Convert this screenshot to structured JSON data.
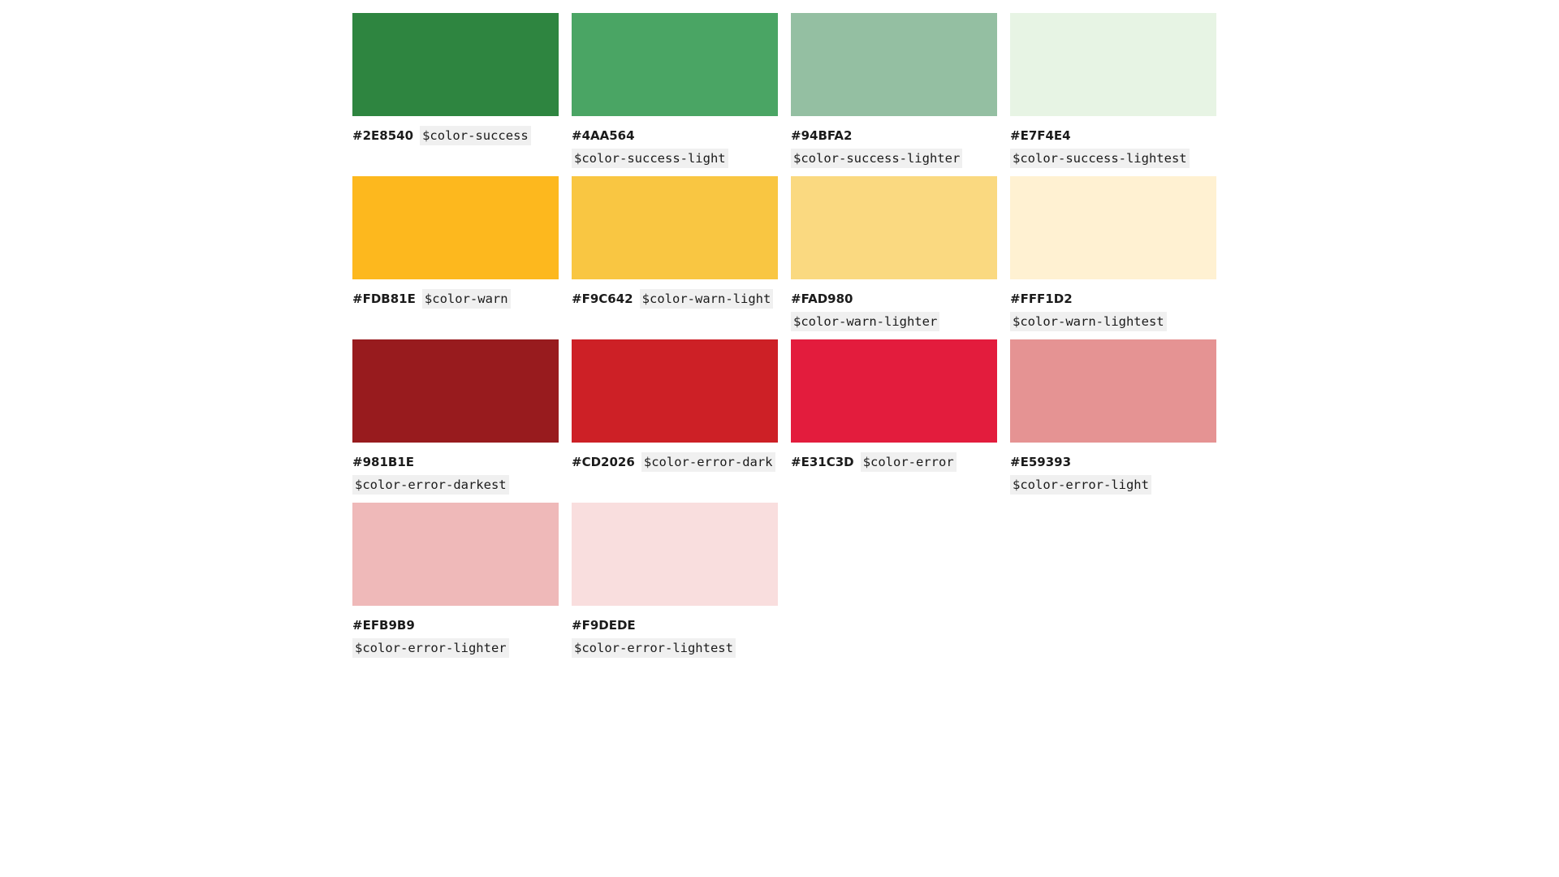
{
  "swatches": [
    {
      "hex": "#2E8540",
      "var": "$color-success",
      "color": "#2E8540"
    },
    {
      "hex": "#4AA564",
      "var": "$color-success-light",
      "color": "#4AA564"
    },
    {
      "hex": "#94BFA2",
      "var": "$color-success-lighter",
      "color": "#94BFA2"
    },
    {
      "hex": "#E7F4E4",
      "var": "$color-success-lightest",
      "color": "#E7F4E4"
    },
    {
      "hex": "#FDB81E",
      "var": "$color-warn",
      "color": "#FDB81E"
    },
    {
      "hex": "#F9C642",
      "var": "$color-warn-light",
      "color": "#F9C642"
    },
    {
      "hex": "#FAD980",
      "var": "$color-warn-lighter",
      "color": "#FAD980"
    },
    {
      "hex": "#FFF1D2",
      "var": "$color-warn-lightest",
      "color": "#FFF1D2"
    },
    {
      "hex": "#981B1E",
      "var": "$color-error-darkest",
      "color": "#981B1E"
    },
    {
      "hex": "#CD2026",
      "var": "$color-error-dark",
      "color": "#CD2026"
    },
    {
      "hex": "#E31C3D",
      "var": "$color-error",
      "color": "#E31C3D"
    },
    {
      "hex": "#E59393",
      "var": "$color-error-light",
      "color": "#E59393"
    },
    {
      "hex": "#EFB9B9",
      "var": "$color-error-lighter",
      "color": "#EFB9B9"
    },
    {
      "hex": "#F9DEDE",
      "var": "$color-error-lightest",
      "color": "#F9DEDE"
    }
  ]
}
